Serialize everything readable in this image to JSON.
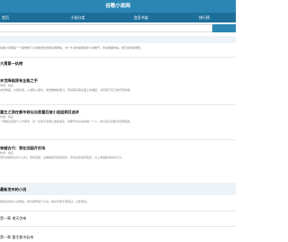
{
  "header": {
    "title": "谷歌小说网"
  },
  "nav": [
    "首页",
    "小说分类",
    "会员书架",
    "排行榜"
  ],
  "search": {
    "placeholder": "",
    "button": ""
  },
  "intro": "谷歌小说网是一个提供热门小说免费在线阅读的网站，为广大书友提供最新小说章节，欢迎收藏本站，我们会持续更新。",
  "items": [
    {
      "title": "大周第一纨绔",
      "meta": "",
      "desc": ""
    },
    {
      "title": "末世降临我有全能之手",
      "meta": "作者：佚名",
      "desc": "末世降临，灾难来袭，人类陷入绝境，他觉醒神秘能力，带领幸存者在废土中崛起，书写属于自己的传奇故事。"
    },
    {
      "title": "重生之我在都市修仙当首富后被小姐姐疯狂追求",
      "meta": "作者：佚名",
      "desc": "一朝重生回到十八岁那年，这一次他不会再让遗憾发生，他要守护身边的每一个人，成为真正的都市至尊强者。"
    },
    {
      "title": "穿越古代：我在田园开农场",
      "meta": "作者：佚名",
      "desc": "意外穿越到古代小山村，家徒四壁，且看她如何种田经商，带领全家发家致富，过上幸福美满的好日子。"
    }
  ],
  "section": {
    "title": "最新发布的小说",
    "subtitle": "更新最快的小说网站，每天推荐热门小说，精彩内容不容错过，立即阅读。",
    "links": [
      "第一章 诸天剑帝",
      "第一章 重生都市仙帝"
    ]
  }
}
